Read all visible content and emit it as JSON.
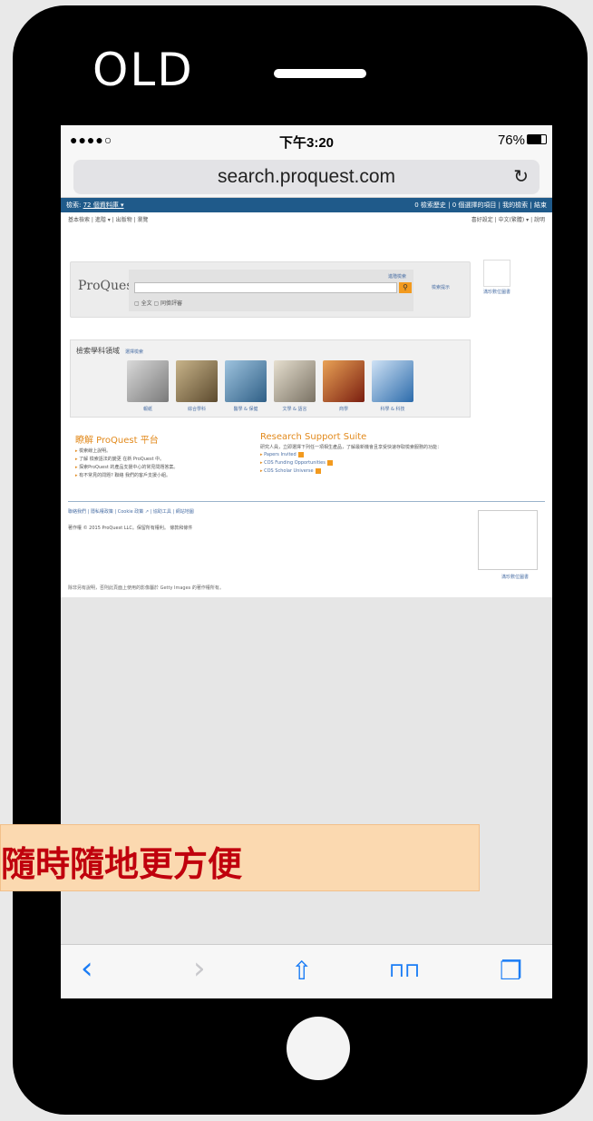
{
  "overlay": {
    "label": "OLD",
    "banner": "隨時隨地更方便"
  },
  "status": {
    "signal": "●●●●○",
    "carrier_icons": " ",
    "time": "下午3:20",
    "battery": "76%"
  },
  "browser": {
    "url": "search.proquest.com",
    "reload": "↻"
  },
  "proquest": {
    "topbar_left": "檢索:",
    "topbar_db": "72 個資料庫 ▾",
    "topbar_right": "0 檢索歷史 | 0 個選擇的項目 | 我的檢索 | 結束",
    "nav_left": "基本檢索 | 進階 ▾ | 出版物 | 瀏覽",
    "nav_right": "喜好設定 | 中文(繁體) ▾ | 說明",
    "logo": "ProQuest",
    "advanced": "進階檢索",
    "options": "▢ 全文  ▢ 同儕評審",
    "search_tip": "檢索提示",
    "side_link": "滿珍數位圖書",
    "subjects_title": "檢索學科領域",
    "subjects_link": "選擇檢索",
    "subjects": [
      {
        "label": "報紙",
        "color": "#8c8c8c"
      },
      {
        "label": "綜合學科",
        "color": "#a1865e"
      },
      {
        "label": "醫學 & 保健",
        "color": "#5a8fb3"
      },
      {
        "label": "文學 & 語言",
        "color": "#b5ab98"
      },
      {
        "label": "商學",
        "color": "#b34a2a"
      },
      {
        "label": "科學 & 科技",
        "color": "#5d91c6"
      }
    ],
    "learn_title": "瞭解 ProQuest 平台",
    "learn_items": [
      "檢索線上說明。",
      "了解 檢索語法的變更 在新 ProQuest 中。",
      "探索ProQuest 的產品支援中心的常見問題答案。",
      "有不常見的問題? 聯絡 我們的客戶支援小組。"
    ],
    "research_title": "Research Support Suite",
    "research_desc": "研究人員，立即選擇下列任一項相生產品，了解最新機會且享受快速存取檢索服務的功能：",
    "research_items": [
      "Papers Invited",
      "COS Funding Opportunities",
      "COS Scholar Universe"
    ],
    "footer_links": "聯絡我們 | 隱私權政策 | Cookie 政策 ↗ | 協助工具 | 網站地圖",
    "copyright": "著作權 © 2015 ProQuest LLC。保留所有權利。 條款和條件",
    "footer_box_link": "滿珍數位圖書",
    "getty": "除非另有說明，否則此頁面上使用的影像屬於 Getty Images 的著作權所有。"
  },
  "toolbar": {
    "back": "‹",
    "forward": "›",
    "share": "⇧",
    "bookmarks": "⊓⊓",
    "tabs": "❐"
  },
  "colors": {
    "topbar": "#1f5a8a",
    "accent_orange": "#e2891b",
    "link_blue": "#4a6fa5",
    "banner_bg": "#fbd9b0",
    "banner_text": "#c0000d",
    "ios_blue": "#1a7cf5"
  },
  "battery_level": 0.76
}
